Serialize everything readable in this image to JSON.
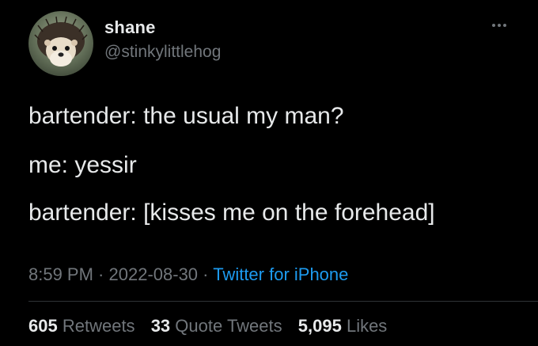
{
  "author": {
    "name": "shane",
    "handle": "@stinkylittlehog",
    "avatar_icon": "hedgehog-avatar"
  },
  "tweet": {
    "lines": [
      "bartender: the usual my man?",
      "me: yessir",
      "bartender: [kisses me on the forehead]"
    ],
    "time": "8:59 PM",
    "separator": " · ",
    "date": "2022-08-30",
    "source": "Twitter for iPhone"
  },
  "stats": {
    "retweets_count": "605",
    "retweets_label": "Retweets",
    "quotes_count": "33",
    "quotes_label": "Quote Tweets",
    "likes_count": "5,095",
    "likes_label": "Likes"
  },
  "colors": {
    "background": "#000000",
    "text": "#e7e9ea",
    "muted": "#71767b",
    "link": "#1d9bf0",
    "divider": "#2f3336"
  }
}
